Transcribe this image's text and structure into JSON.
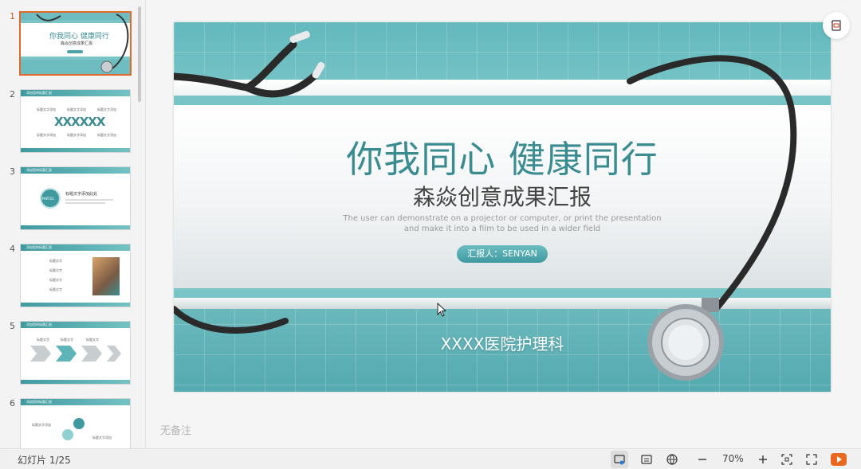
{
  "status": {
    "slide_counter": "幻灯片 1/25",
    "zoom": "70%"
  },
  "notes": {
    "placeholder": "无备注"
  },
  "slide": {
    "title": "你我同心 健康同行",
    "subtitle": "森焱创意成果汇报",
    "english_line1": "The user can demonstrate on a projector or computer, or print the presentation",
    "english_line2": "and make it into a film to be used in a wider field",
    "reporter": "汇报人：SENYAN",
    "hospital": "XXXX医院护理科"
  },
  "thumbnails": [
    {
      "number": "1",
      "title": "你我同心 健康同行",
      "subtitle": "森焱创意成果汇报"
    },
    {
      "number": "2",
      "header": "添加您的标题汇报",
      "labels": [
        "标题文字添加",
        "标题文字添加",
        "标题文字添加"
      ],
      "center": "XXXXXX"
    },
    {
      "number": "3",
      "header": "添加您的标题汇报",
      "part": "PART01",
      "heading": "标题文字添加此处"
    },
    {
      "number": "4",
      "header": "添加您的标题汇报",
      "labels": [
        "标题文字",
        "标题文字",
        "标题文字",
        "标题文字"
      ]
    },
    {
      "number": "5",
      "header": "添加您的标题汇报",
      "labels": [
        "标题文字",
        "标题文字",
        "标题文字"
      ]
    },
    {
      "number": "6",
      "header": "添加您的标题汇报",
      "labels": [
        "标题文字添加",
        "标题文字添加"
      ]
    }
  ],
  "colors": {
    "accent": "#e06a2c",
    "teal": "#3a8c91",
    "play": "#e8691f"
  },
  "icons": [
    "export-icon",
    "normal-view-icon",
    "notes-icon",
    "reading-view-icon",
    "zoom-out-icon",
    "zoom-in-icon",
    "fit-icon",
    "fullscreen-icon",
    "play-icon"
  ]
}
